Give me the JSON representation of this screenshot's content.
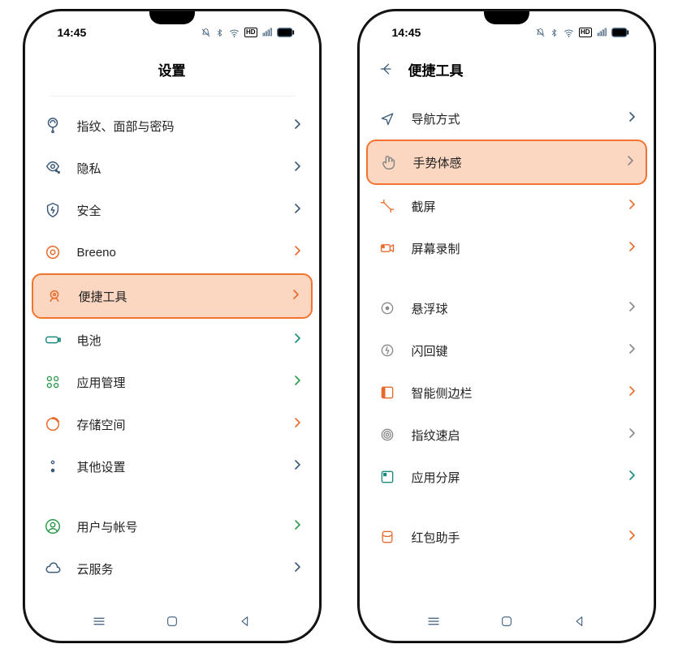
{
  "status": {
    "time": "14:45"
  },
  "left": {
    "title": "设置",
    "items": [
      {
        "icon": "fingerprint",
        "label": "指纹、面部与密码"
      },
      {
        "icon": "privacy",
        "label": "隐私"
      },
      {
        "icon": "security",
        "label": "安全"
      },
      {
        "icon": "breeno",
        "label": "Breeno"
      },
      {
        "icon": "tools",
        "label": "便捷工具",
        "highlight": true
      },
      {
        "icon": "battery",
        "label": "电池"
      },
      {
        "icon": "apps",
        "label": "应用管理"
      },
      {
        "icon": "storage",
        "label": "存储空间"
      },
      {
        "icon": "other",
        "label": "其他设置"
      }
    ],
    "items2": [
      {
        "icon": "user",
        "label": "用户与帐号"
      },
      {
        "icon": "cloud",
        "label": "云服务"
      }
    ]
  },
  "right": {
    "title": "便捷工具",
    "groups": [
      [
        {
          "icon": "nav",
          "label": "导航方式"
        },
        {
          "icon": "gesture",
          "label": "手势体感",
          "highlight": true
        },
        {
          "icon": "screenshot",
          "label": "截屏"
        },
        {
          "icon": "record",
          "label": "屏幕录制"
        }
      ],
      [
        {
          "icon": "floatball",
          "label": "悬浮球"
        },
        {
          "icon": "flashback",
          "label": "闪回键"
        },
        {
          "icon": "sidebar",
          "label": "智能侧边栏"
        },
        {
          "icon": "fpquick",
          "label": "指纹速启"
        },
        {
          "icon": "splitscreen",
          "label": "应用分屏"
        }
      ],
      [
        {
          "icon": "redpacket",
          "label": "红包助手"
        }
      ]
    ]
  }
}
